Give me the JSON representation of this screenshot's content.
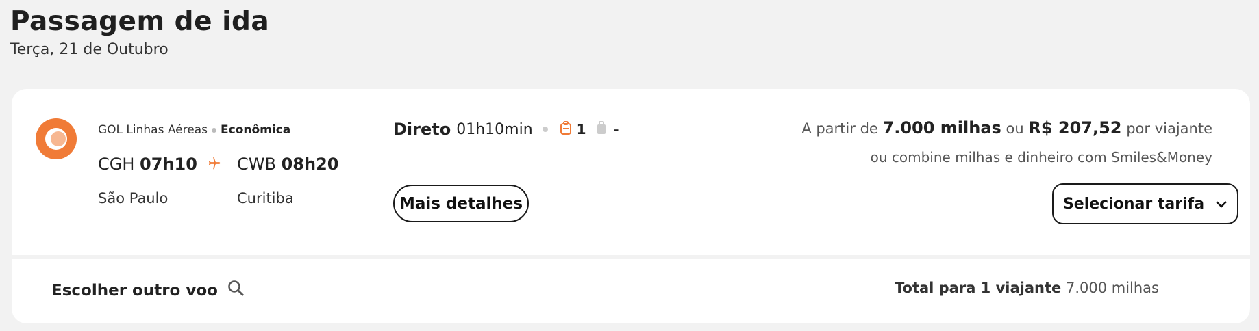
{
  "header": {
    "title": "Passagem de ida",
    "date": "Terça, 21 de Outubro"
  },
  "flight": {
    "airline": "GOL Linhas Aéreas",
    "cabin": "Econômica",
    "origin_code": "CGH",
    "origin_time": "07h10",
    "origin_city": "São Paulo",
    "dest_code": "CWB",
    "dest_time": "08h20",
    "dest_city": "Curitiba",
    "stops": "Direto",
    "duration": "01h10min",
    "bags_count": "1",
    "checked_bags": "-",
    "details_label": "Mais detalhes"
  },
  "pricing": {
    "from_label": "A partir de",
    "miles": "7.000 milhas",
    "or_label": "ou",
    "cash": "R$ 207,52",
    "per_label": "por viajante",
    "combine_text": "ou combine milhas e dinheiro com Smiles&Money",
    "select_label": "Selecionar tarifa"
  },
  "footer": {
    "other_flight_label": "Escolher outro voo",
    "total_label": "Total para 1 viajante",
    "total_value": "7.000 milhas"
  },
  "colors": {
    "accent": "#f07b37",
    "background": "#f2f2f2",
    "card": "#ffffff"
  },
  "icons": [
    "gol-logo-icon",
    "plane-icon",
    "backpack-icon",
    "luggage-icon",
    "chevron-down-icon",
    "search-icon"
  ]
}
